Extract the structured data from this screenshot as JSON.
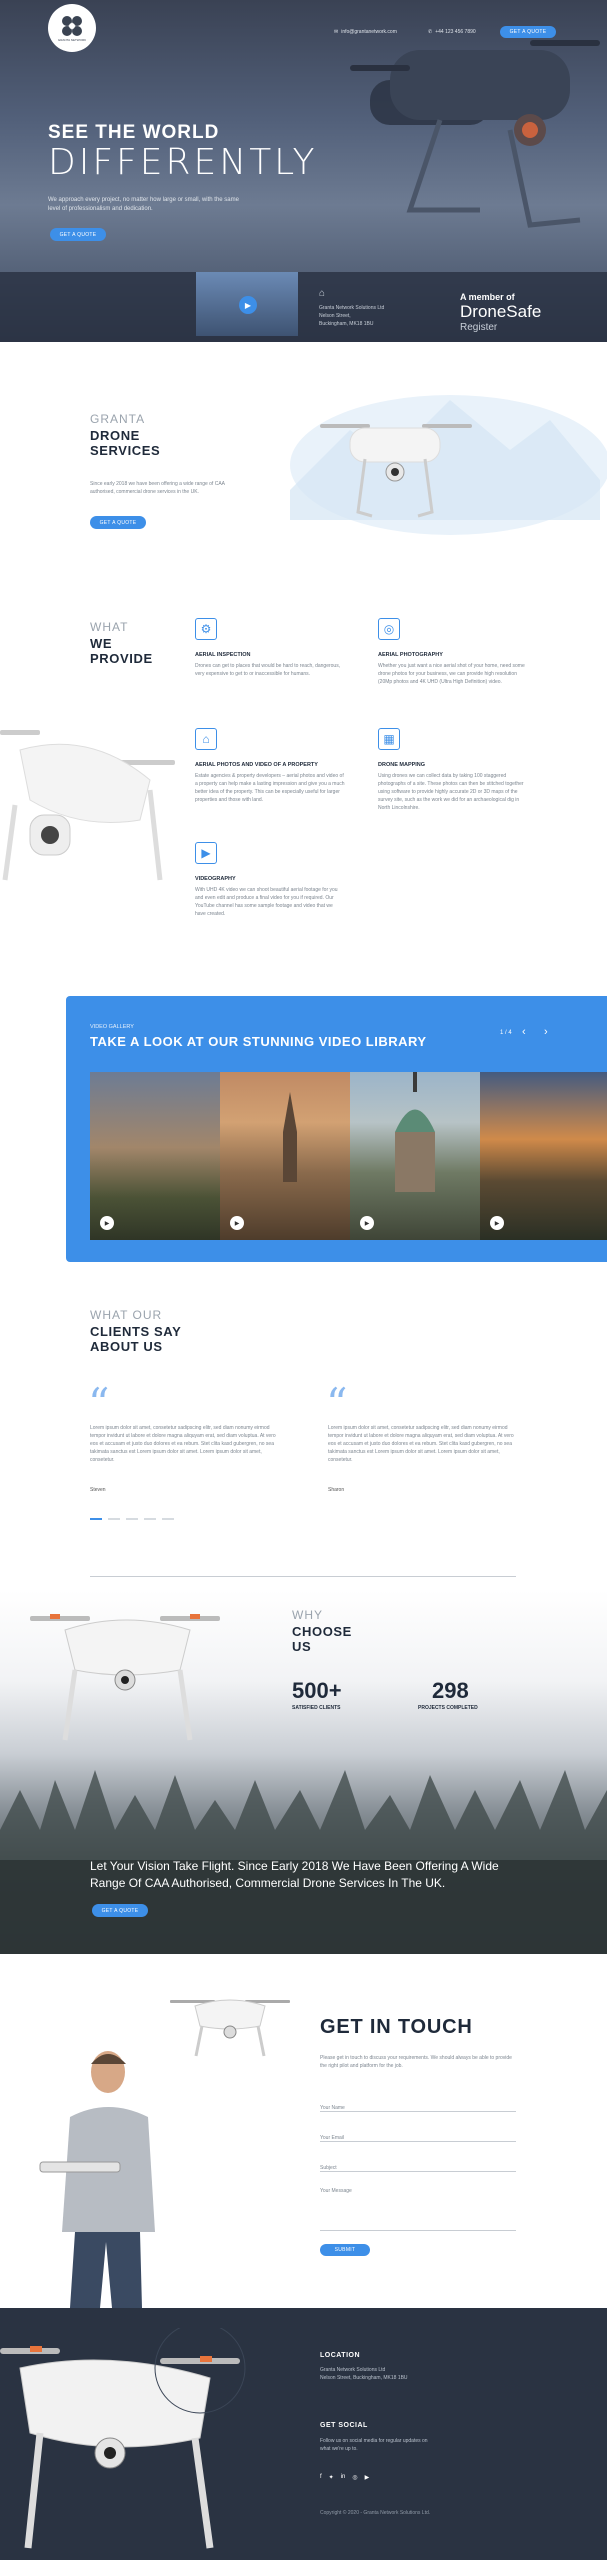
{
  "header": {
    "email": "info@grantanetwork.com",
    "phone": "+44 123 456 7890",
    "cta": "GET A QUOTE",
    "logo_text": "GRANTA NETWORK"
  },
  "hero": {
    "title_top": "SEE THE WORLD",
    "title_bottom": "DIFFERENTLY",
    "text": "We approach every project, no matter how large or small, with the same level of professionalism and dedication.",
    "cta": "GET A QUOTE"
  },
  "hero_bar": {
    "address": [
      "Granta Network Solutions Ltd",
      "Nelson Street,",
      "Buckingham, MK18 1BU"
    ],
    "member_label": "A member of",
    "brand": "DroneSafe",
    "brand_sub": "Register"
  },
  "services": {
    "kicker": "GRANTA",
    "title_1": "DRONE",
    "title_2": "SERVICES",
    "text": "Since early 2018 we have been offering a wide range of CAA authorised, commercial drone services in the UK.",
    "cta": "GET A QUOTE"
  },
  "provide": {
    "kicker": "WHAT",
    "title_1": "WE",
    "title_2": "PROVIDE",
    "items": [
      {
        "title": "AERIAL INSPECTION",
        "text": "Drones can get to places that would be hard to reach, dangerous, very expensive to get to or inaccessible for humans."
      },
      {
        "title": "AERIAL PHOTOGRAPHY",
        "text": "Whether you just want a nice aerial shot of your home, need some drone photos for your business, we can provide high resolution (20Mp photos and 4K UHD (Ultra High Definition) video."
      },
      {
        "title": "AERIAL PHOTOS AND VIDEO OF A PROPERTY",
        "text": "Estate agencies & property developers – aerial photos and video of a property can help make a lasting impression and give you a much better idea of the property. This can be especially useful for larger properties and those with land."
      },
      {
        "title": "DRONE MAPPING",
        "text": "Using drones we can collect data by taking 100 staggered photographs of a site. These photos can then be stitched together using software to provide highly accurate 2D or 3D maps of the survey site, such as the work we did for an archaeological dig in North Lincolnshire."
      },
      {
        "title": "VIDEOGRAPHY",
        "text": "With UHD 4K video we can shoot beautiful aerial footage for you and even edit and produce a final video for you if required. Our YouTube channel has some sample footage and video that we have created."
      }
    ]
  },
  "gallery": {
    "kicker": "VIDEO GALLERY",
    "title": "TAKE A LOOK AT OUR STUNNING VIDEO LIBRARY",
    "pager": "1 / 4",
    "prev": "‹",
    "next": "›"
  },
  "clients": {
    "kicker": "WHAT OUR",
    "title_1": "CLIENTS SAY",
    "title_2": "ABOUT US",
    "quotes": [
      {
        "text": "Lorem ipsum dolor sit amet, consetetur sadipscing elitr, sed diam nonumy eirmod tempor invidunt ut labore et dolore magna aliquyam erat, sed diam voluptua. At vero eos et accusam et justo duo dolores et ea rebum. Stet clita kasd gubergren, no sea takimata sanctus est Lorem ipsum dolor sit amet. Lorem ipsum dolor sit amet, consetetur.",
        "name": "Steven"
      },
      {
        "text": "Lorem ipsum dolor sit amet, consetetur sadipscing elitr, sed diam nonumy eirmod tempor invidunt ut labore et dolore magna aliquyam erat, sed diam voluptua. At vero eos et accusam et justo duo dolores et ea rebum. Stet clita kasd gubergren, no sea takimata sanctus est Lorem ipsum dolor sit amet. Lorem ipsum dolor sit amet, consetetur.",
        "name": "Sharon"
      }
    ]
  },
  "why": {
    "kicker": "WHY",
    "title_1": "CHOOSE",
    "title_2": "US",
    "stat1_value": "500+",
    "stat1_label": "SATISFIED CLIENTS",
    "stat2_value": "298",
    "stat2_label": "PROJECTS COMPLETED"
  },
  "flight": {
    "text": "Let Your Vision Take Flight. Since Early 2018 We Have Been Offering A Wide Range Of CAA Authorised, Commercial Drone Services In The UK.",
    "cta": "GET A QUOTE"
  },
  "contact": {
    "title": "GET IN TOUCH",
    "text": "Please get in touch to discuss your requirements. We should always be able to provide the right pilot and platform for the job.",
    "name": "Your Name",
    "email": "Your Email",
    "subject": "Subject",
    "message": "Your Message",
    "submit": "SUBMIT"
  },
  "footer": {
    "location_title": "LOCATION",
    "location_1": "Granta Network Solutions Ltd",
    "location_2": "Nelson Street, Buckingham, MK18 1BU",
    "social_title": "GET SOCIAL",
    "social_text": "Follow us on social media for regular updates on what we're up to.",
    "copyright": "Copyright © 2020 - Granta Network Solutions Ltd."
  },
  "colors": {
    "accent": "#3d8fe8",
    "dark": "#283040",
    "footer": "#2a3342"
  }
}
